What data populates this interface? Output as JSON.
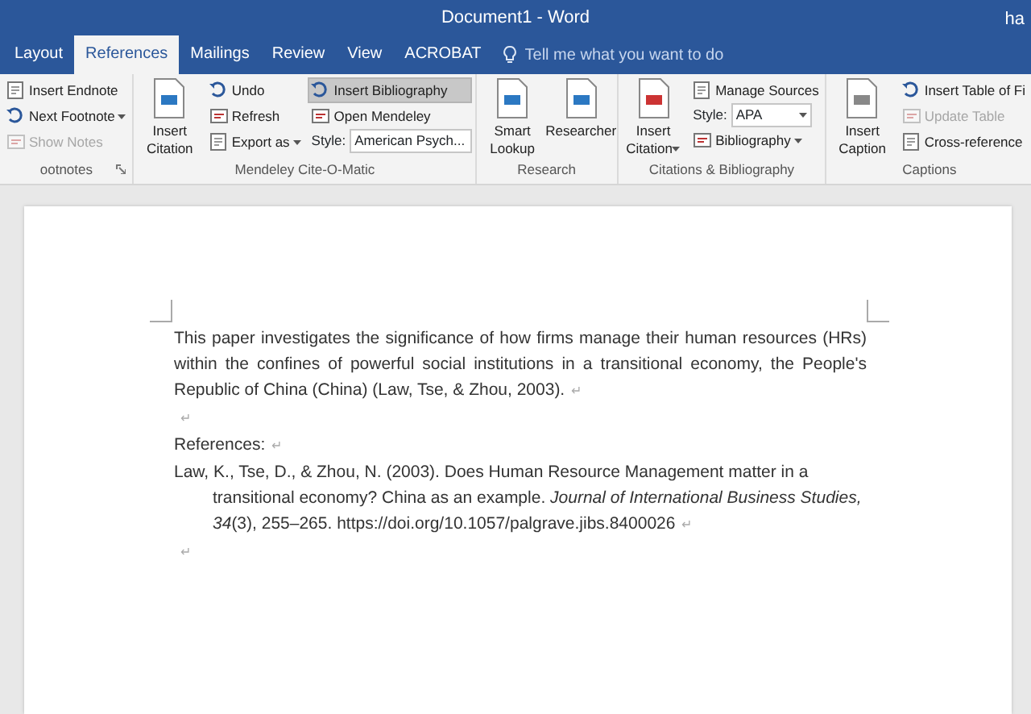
{
  "window": {
    "title": "Document1  -  Word",
    "user": "ha"
  },
  "tabs": [
    {
      "label": "Layout",
      "selected": false
    },
    {
      "label": "References",
      "selected": true
    },
    {
      "label": "Mailings",
      "selected": false
    },
    {
      "label": "Review",
      "selected": false
    },
    {
      "label": "View",
      "selected": false
    },
    {
      "label": "ACROBAT",
      "selected": false
    }
  ],
  "tell_me": {
    "placeholder": "Tell me what you want to do"
  },
  "ribbon": {
    "groups": [
      {
        "label": "ootnotes",
        "launcher": true,
        "columns": [
          [
            {
              "kind": "small",
              "label": "Insert Endnote",
              "dropdown": false,
              "disabled": false,
              "highlighted": false
            },
            {
              "kind": "small",
              "label": "Next Footnote",
              "dropdown": true,
              "disabled": false,
              "highlighted": false
            },
            {
              "kind": "small",
              "label": "Show Notes",
              "dropdown": false,
              "disabled": true,
              "highlighted": false
            }
          ]
        ]
      },
      {
        "label": "Mendeley Cite-O-Matic",
        "launcher": false,
        "columns": [
          [
            {
              "kind": "large",
              "label": "Insert Citation",
              "dropdown": false
            }
          ],
          [
            {
              "kind": "small",
              "label": "Undo",
              "dropdown": false,
              "disabled": false,
              "highlighted": false
            },
            {
              "kind": "small",
              "label": "Refresh",
              "dropdown": false,
              "disabled": false,
              "highlighted": false
            },
            {
              "kind": "small",
              "label": "Export as",
              "dropdown": true,
              "disabled": false,
              "highlighted": false
            }
          ],
          [
            {
              "kind": "small",
              "label": "Insert Bibliography",
              "dropdown": false,
              "disabled": false,
              "highlighted": true
            },
            {
              "kind": "small",
              "label": "Open Mendeley",
              "dropdown": false,
              "disabled": false,
              "highlighted": false
            },
            {
              "kind": "select",
              "label": "Style:",
              "value": "American Psych..."
            }
          ]
        ]
      },
      {
        "label": "Research",
        "launcher": false,
        "columns": [
          [
            {
              "kind": "large",
              "label": "Smart Lookup",
              "dropdown": false
            }
          ],
          [
            {
              "kind": "large",
              "label": "Researcher",
              "dropdown": false
            }
          ]
        ]
      },
      {
        "label": "Citations & Bibliography",
        "launcher": false,
        "columns": [
          [
            {
              "kind": "large",
              "label": "Insert Citation",
              "dropdown": true
            }
          ],
          [
            {
              "kind": "small",
              "label": "Manage Sources",
              "dropdown": false,
              "disabled": false,
              "highlighted": false
            },
            {
              "kind": "select",
              "label": "Style:",
              "value": "APA"
            },
            {
              "kind": "small",
              "label": "Bibliography",
              "dropdown": true,
              "disabled": false,
              "highlighted": false
            }
          ]
        ]
      },
      {
        "label": "Captions",
        "launcher": false,
        "columns": [
          [
            {
              "kind": "large",
              "label": "Insert Caption",
              "dropdown": false
            }
          ],
          [
            {
              "kind": "small",
              "label": "Insert Table of Fi",
              "dropdown": false,
              "disabled": false,
              "highlighted": false
            },
            {
              "kind": "small",
              "label": "Update Table",
              "dropdown": false,
              "disabled": true,
              "highlighted": false
            },
            {
              "kind": "small",
              "label": "Cross-reference",
              "dropdown": false,
              "disabled": false,
              "highlighted": false
            }
          ]
        ]
      }
    ]
  },
  "document": {
    "paragraphs": [
      {
        "kind": "body",
        "text": "This paper investigates the significance of how firms manage their human resources (HRs) within the confines of powerful social institutions in a transitional economy, the People's Republic of China (China) (Law, Tse, & Zhou, 2003).",
        "mark": "↵"
      },
      {
        "kind": "empty",
        "mark": "↵"
      },
      {
        "kind": "body",
        "text": "References:",
        "mark": "↵"
      },
      {
        "kind": "hanging",
        "text": "Law, K., Tse, D., & Zhou, N. (2003). Does Human Resource Management matter in a transitional economy? China as an example. *Journal of International Business Studies, 34*(3), 255–265. https://doi.org/10.1057/palgrave.jibs.8400026",
        "mark": "↵"
      },
      {
        "kind": "empty",
        "mark": "↵"
      }
    ]
  }
}
